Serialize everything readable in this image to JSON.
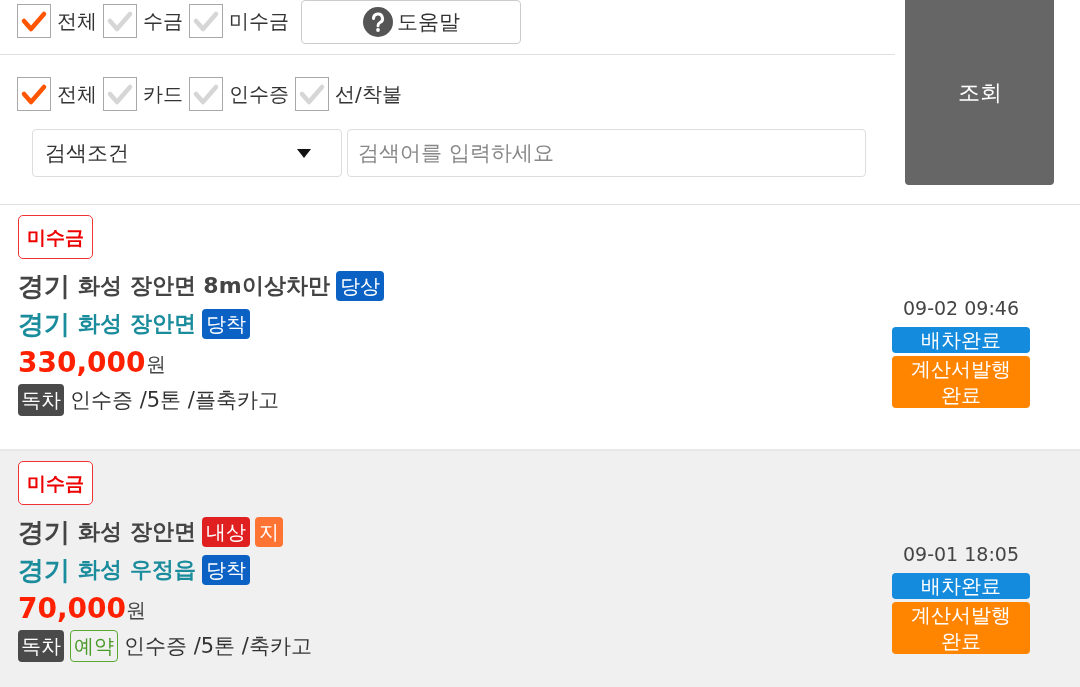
{
  "filters": {
    "payment_checks": [
      {
        "label": "전체",
        "checked": true
      },
      {
        "label": "수금",
        "checked": false
      },
      {
        "label": "미수금",
        "checked": false
      }
    ],
    "help_button": {
      "label": "도움말"
    },
    "type_checks": [
      {
        "label": "전체",
        "checked": true
      },
      {
        "label": "카드",
        "checked": false
      },
      {
        "label": "인수증",
        "checked": false
      },
      {
        "label": "선/착불",
        "checked": false
      }
    ],
    "search": {
      "condition": "검색조건",
      "placeholder": "검색어를 입력하세요"
    },
    "query_button": {
      "label": "조회"
    }
  },
  "orders": [
    {
      "selected": false,
      "payment_badge": "미수금",
      "pickup": {
        "region": "경기",
        "place": "화성 장안면 8m이상차만",
        "tags": [
          {
            "label": "당상",
            "color": "#0b62c4"
          }
        ]
      },
      "dropoff": {
        "region": "경기",
        "place": "화성 장안면",
        "tags": [
          {
            "label": "당착",
            "color": "#0b62c4"
          }
        ]
      },
      "price": "330,000",
      "unit": "원",
      "tags": [
        {
          "label": "독차",
          "kind": "solid"
        }
      ],
      "detail": "인수증 /5톤 /플축카고",
      "time": "09-02 09:46",
      "statuses": [
        {
          "label": "배차완료",
          "color": "#148bdd"
        },
        {
          "label": "계산서발행 완료",
          "color": "#ff8400"
        }
      ]
    },
    {
      "selected": true,
      "payment_badge": "미수금",
      "pickup": {
        "region": "경기",
        "place": "화성 장안면",
        "tags": [
          {
            "label": "내상",
            "color": "#e02020"
          },
          {
            "label": "지",
            "color": "#ff7433"
          }
        ]
      },
      "dropoff": {
        "region": "경기",
        "place": "화성 우정읍",
        "tags": [
          {
            "label": "당착",
            "color": "#0b62c4"
          }
        ]
      },
      "price": "70,000",
      "unit": "원",
      "tags": [
        {
          "label": "독차",
          "kind": "solid"
        },
        {
          "label": "예약",
          "kind": "outline"
        }
      ],
      "detail": "인수증 /5톤 /축카고",
      "time": "09-01 18:05",
      "statuses": [
        {
          "label": "배차완료",
          "color": "#148bdd"
        },
        {
          "label": "계산서발행 완료",
          "color": "#ff8400"
        }
      ]
    }
  ]
}
